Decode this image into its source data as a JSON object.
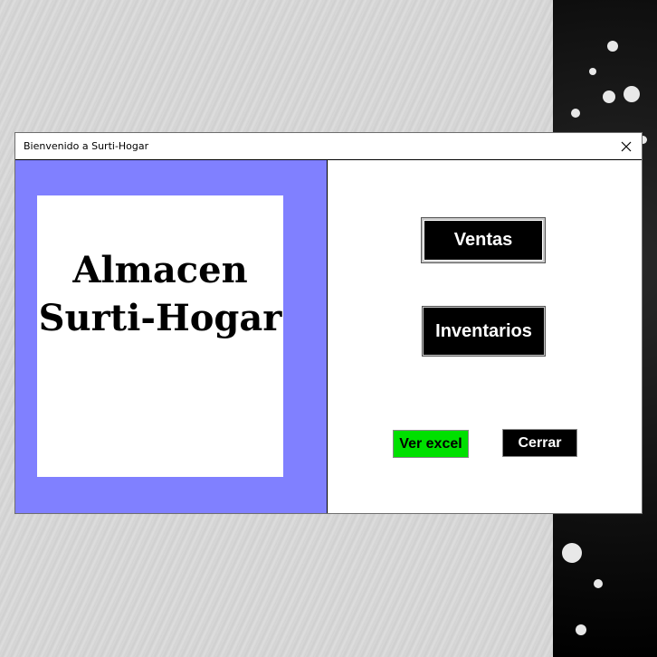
{
  "window": {
    "title": "Bienvenido a Surti-Hogar",
    "close_symbol": "✕"
  },
  "logo": {
    "line1": "Almacen",
    "line2": "Surti-Hogar"
  },
  "buttons": {
    "ventas": "Ventas",
    "inventarios": "Inventarios",
    "ver_excel": "Ver excel",
    "cerrar": "Cerrar"
  },
  "colors": {
    "left_panel": "#8080ff",
    "excel_button": "#00e000",
    "primary_button": "#000000"
  },
  "icons": {
    "close": "close-icon"
  }
}
